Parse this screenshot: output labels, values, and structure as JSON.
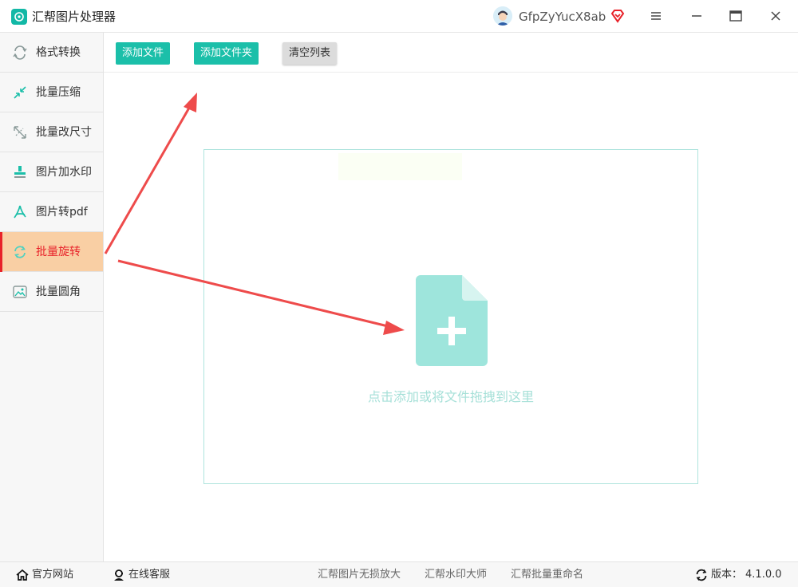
{
  "app": {
    "title": "汇帮图片处理器",
    "username": "GfpZyYucX8ab"
  },
  "sidebar": {
    "items": [
      {
        "label": "格式转换",
        "icon": "format-convert-icon"
      },
      {
        "label": "批量压缩",
        "icon": "compress-icon"
      },
      {
        "label": "批量改尺寸",
        "icon": "resize-icon"
      },
      {
        "label": "图片加水印",
        "icon": "watermark-icon"
      },
      {
        "label": "图片转pdf",
        "icon": "pdf-icon"
      },
      {
        "label": "批量旋转",
        "icon": "rotate-icon",
        "active": true
      },
      {
        "label": "批量圆角",
        "icon": "round-corner-icon"
      }
    ]
  },
  "toolbar": {
    "add_file": "添加文件",
    "add_folder": "添加文件夹",
    "clear_list": "清空列表"
  },
  "dropzone": {
    "hint": "点击添加或将文件拖拽到这里"
  },
  "footer": {
    "website": "官方网站",
    "support": "在线客服",
    "links": [
      "汇帮图片无损放大",
      "汇帮水印大师",
      "汇帮批量重命名"
    ],
    "version_label": "版本：",
    "version": "4.1.0.0"
  },
  "colors": {
    "accent": "#1bbfa9",
    "active_bg": "#f9cfa4",
    "active_text": "#e8222a",
    "arrow": "#ee4b4b",
    "dropzone_icon": "#9ee5dc"
  }
}
